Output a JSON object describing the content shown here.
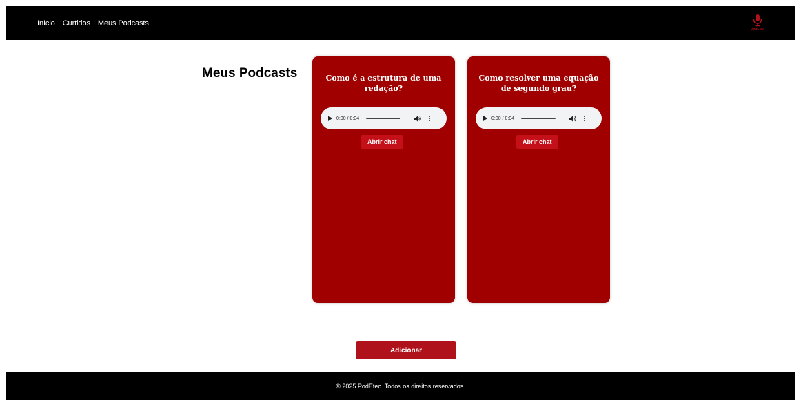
{
  "nav": {
    "links": [
      "Início",
      "Curtidos",
      "Meus Podcasts"
    ],
    "logo_text": "PodEtec",
    "logo_icon": "microphone-icon"
  },
  "main": {
    "heading": "Meus Podcasts",
    "podcasts": [
      {
        "title": "Como é a estrutura de uma redação?",
        "time": "0:00 / 0:04",
        "chat_label": "Abrir chat"
      },
      {
        "title": "Como resolver uma equação de segundo grau?",
        "time": "0:00 / 0:04",
        "chat_label": "Abrir chat"
      }
    ],
    "add_label": "Adicionar"
  },
  "footer": {
    "text": "© 2025 PodEtec. Todos os direitos reservados."
  },
  "colors": {
    "nav_bg": "#000000",
    "card_bg": "#a00000",
    "accent": "#b0121b"
  }
}
